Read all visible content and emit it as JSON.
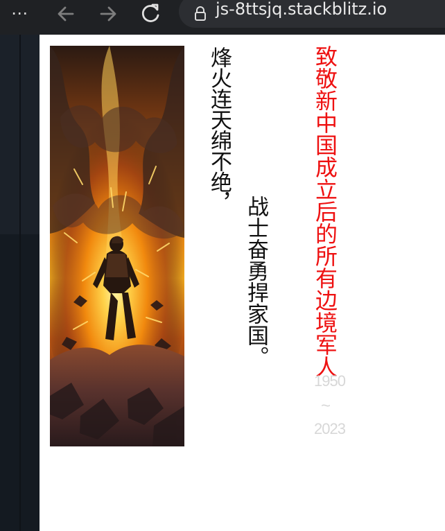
{
  "browser": {
    "menu_icon": "more-horizontal-icon",
    "back_icon": "arrow-left-icon",
    "forward_icon": "arrow-right-icon",
    "reload_icon": "reload-icon",
    "lock_icon": "lock-icon",
    "url": "js-8ttsjq.stackblitz.io"
  },
  "content": {
    "image_name": "soldier-explosion-image",
    "line_one": "烽火连天绵不绝，",
    "line_two": "战士奋勇捍家国。",
    "title": "致敬新中国成立后的所有边境军人",
    "years": {
      "start": "1950",
      "separator": "~",
      "end": "2023"
    }
  },
  "colors": {
    "toolbar_background": "#1f2124",
    "url_background": "#2c2e32",
    "sidebar_background": "#141a21",
    "page_background": "#ffffff",
    "title_red": "#ee1111",
    "poem_text": "#111111",
    "year_text": "#d7d7d7"
  }
}
